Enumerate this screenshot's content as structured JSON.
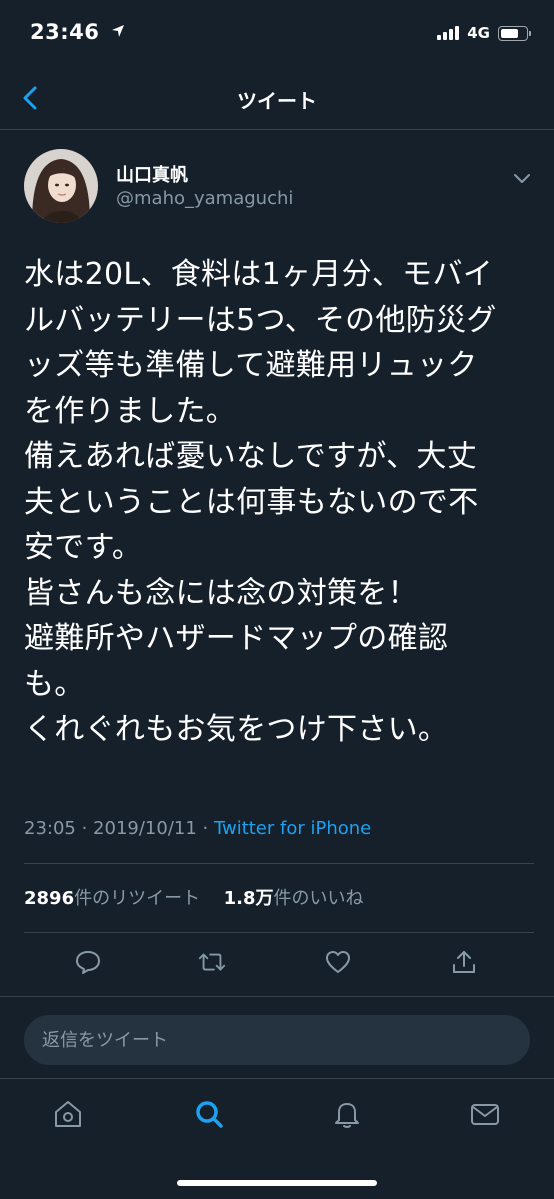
{
  "status_bar": {
    "time": "23:46",
    "network": "4G"
  },
  "nav": {
    "title": "ツイート",
    "back_icon": "chevron-left-icon"
  },
  "author": {
    "name": "山口真帆",
    "handle": "@maho_yamaguchi"
  },
  "tweet": {
    "lines": [
      "水は20L、食料は1ヶ月分、モバイ",
      "ルバッテリーは5つ、その他防災グ",
      "ッズ等も準備して避難用リュック",
      "を作りました。",
      "備えあれば憂いなしですが、大丈",
      "夫ということは何事もないので不",
      "安です。",
      "皆さんも念には念の対策を！",
      "避難所やハザードマップの確認",
      "も。",
      "くれぐれもお気をつけ下さい。"
    ],
    "timestamp": "23:05 · 2019/10/11 · ",
    "source": "Twitter for iPhone"
  },
  "stats": {
    "retweets_count": "2896",
    "retweets_label": "件のリツイート",
    "likes_count": "1.8万",
    "likes_label": "件のいいね"
  },
  "actions": {
    "reply_icon": "comment-icon",
    "retweet_icon": "retweet-icon",
    "like_icon": "heart-icon",
    "share_icon": "share-icon"
  },
  "reply": {
    "placeholder": "返信をツイート"
  },
  "tabs": [
    "home-icon",
    "search-icon",
    "notifications-icon",
    "messages-icon"
  ],
  "colors": {
    "background": "#15202b",
    "accent": "#1da1f2",
    "secondary_text": "#8899a6",
    "divider": "#38444d"
  }
}
